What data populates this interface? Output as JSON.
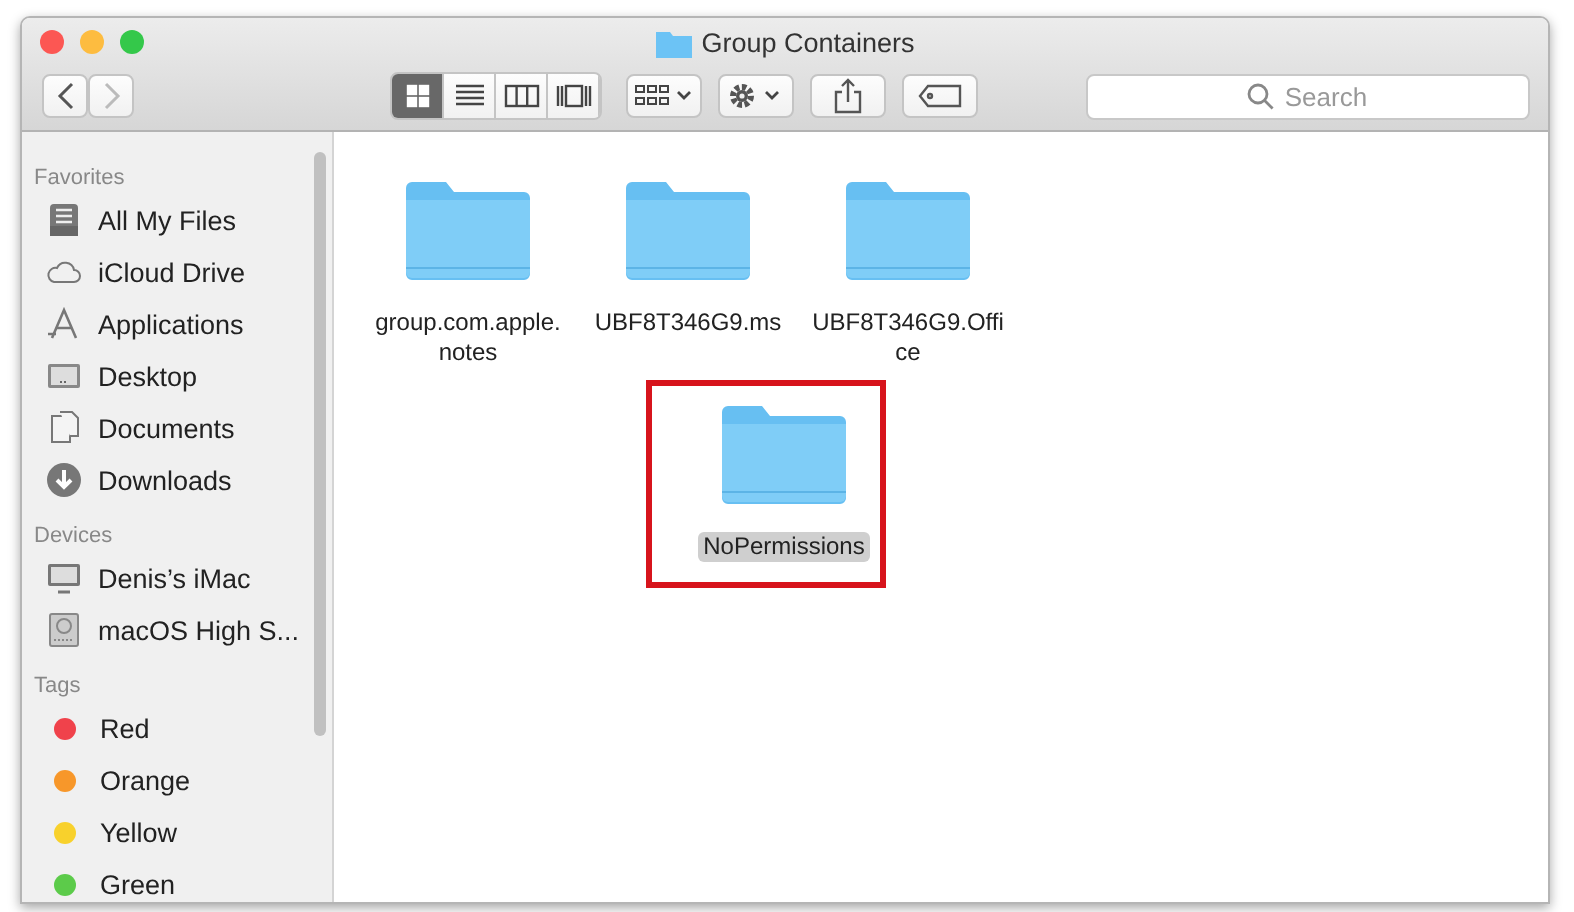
{
  "window": {
    "title": "Group Containers"
  },
  "toolbar": {
    "view_modes": [
      {
        "kind": "icons",
        "selected": true
      },
      {
        "kind": "list",
        "selected": false
      },
      {
        "kind": "columns",
        "selected": false
      },
      {
        "kind": "coverflow",
        "selected": false
      }
    ],
    "search": {
      "placeholder": "Search"
    }
  },
  "sidebar": {
    "sections": [
      {
        "heading": "Favorites",
        "items": [
          {
            "label": "All My Files",
            "kind": "files"
          },
          {
            "label": "iCloud Drive",
            "kind": "cloud"
          },
          {
            "label": "Applications",
            "kind": "apps"
          },
          {
            "label": "Desktop",
            "kind": "desktop"
          },
          {
            "label": "Documents",
            "kind": "documents"
          },
          {
            "label": "Downloads",
            "kind": "downloads"
          }
        ]
      },
      {
        "heading": "Devices",
        "items": [
          {
            "label": "Denis’s iMac",
            "kind": "computer"
          },
          {
            "label": "macOS High S...",
            "kind": "disk"
          }
        ]
      },
      {
        "heading": "Tags",
        "items": [
          {
            "label": "Red",
            "kind": "tag",
            "color": "#f0424b"
          },
          {
            "label": "Orange",
            "kind": "tag",
            "color": "#f7972a"
          },
          {
            "label": "Yellow",
            "kind": "tag",
            "color": "#f8d12c"
          },
          {
            "label": "Green",
            "kind": "tag",
            "color": "#5ccb4a"
          }
        ]
      }
    ]
  },
  "files": [
    {
      "lines": [
        "group.com.apple.",
        "notes"
      ],
      "selected": false,
      "highlighted": false
    },
    {
      "lines": [
        "UBF8T346G9.ms"
      ],
      "selected": false,
      "highlighted": false
    },
    {
      "lines": [
        "UBF8T346G9.Offi",
        "ce"
      ],
      "selected": false,
      "highlighted": false
    },
    {
      "lines": [
        "NoPermissions"
      ],
      "selected": true,
      "highlighted": true
    }
  ]
}
